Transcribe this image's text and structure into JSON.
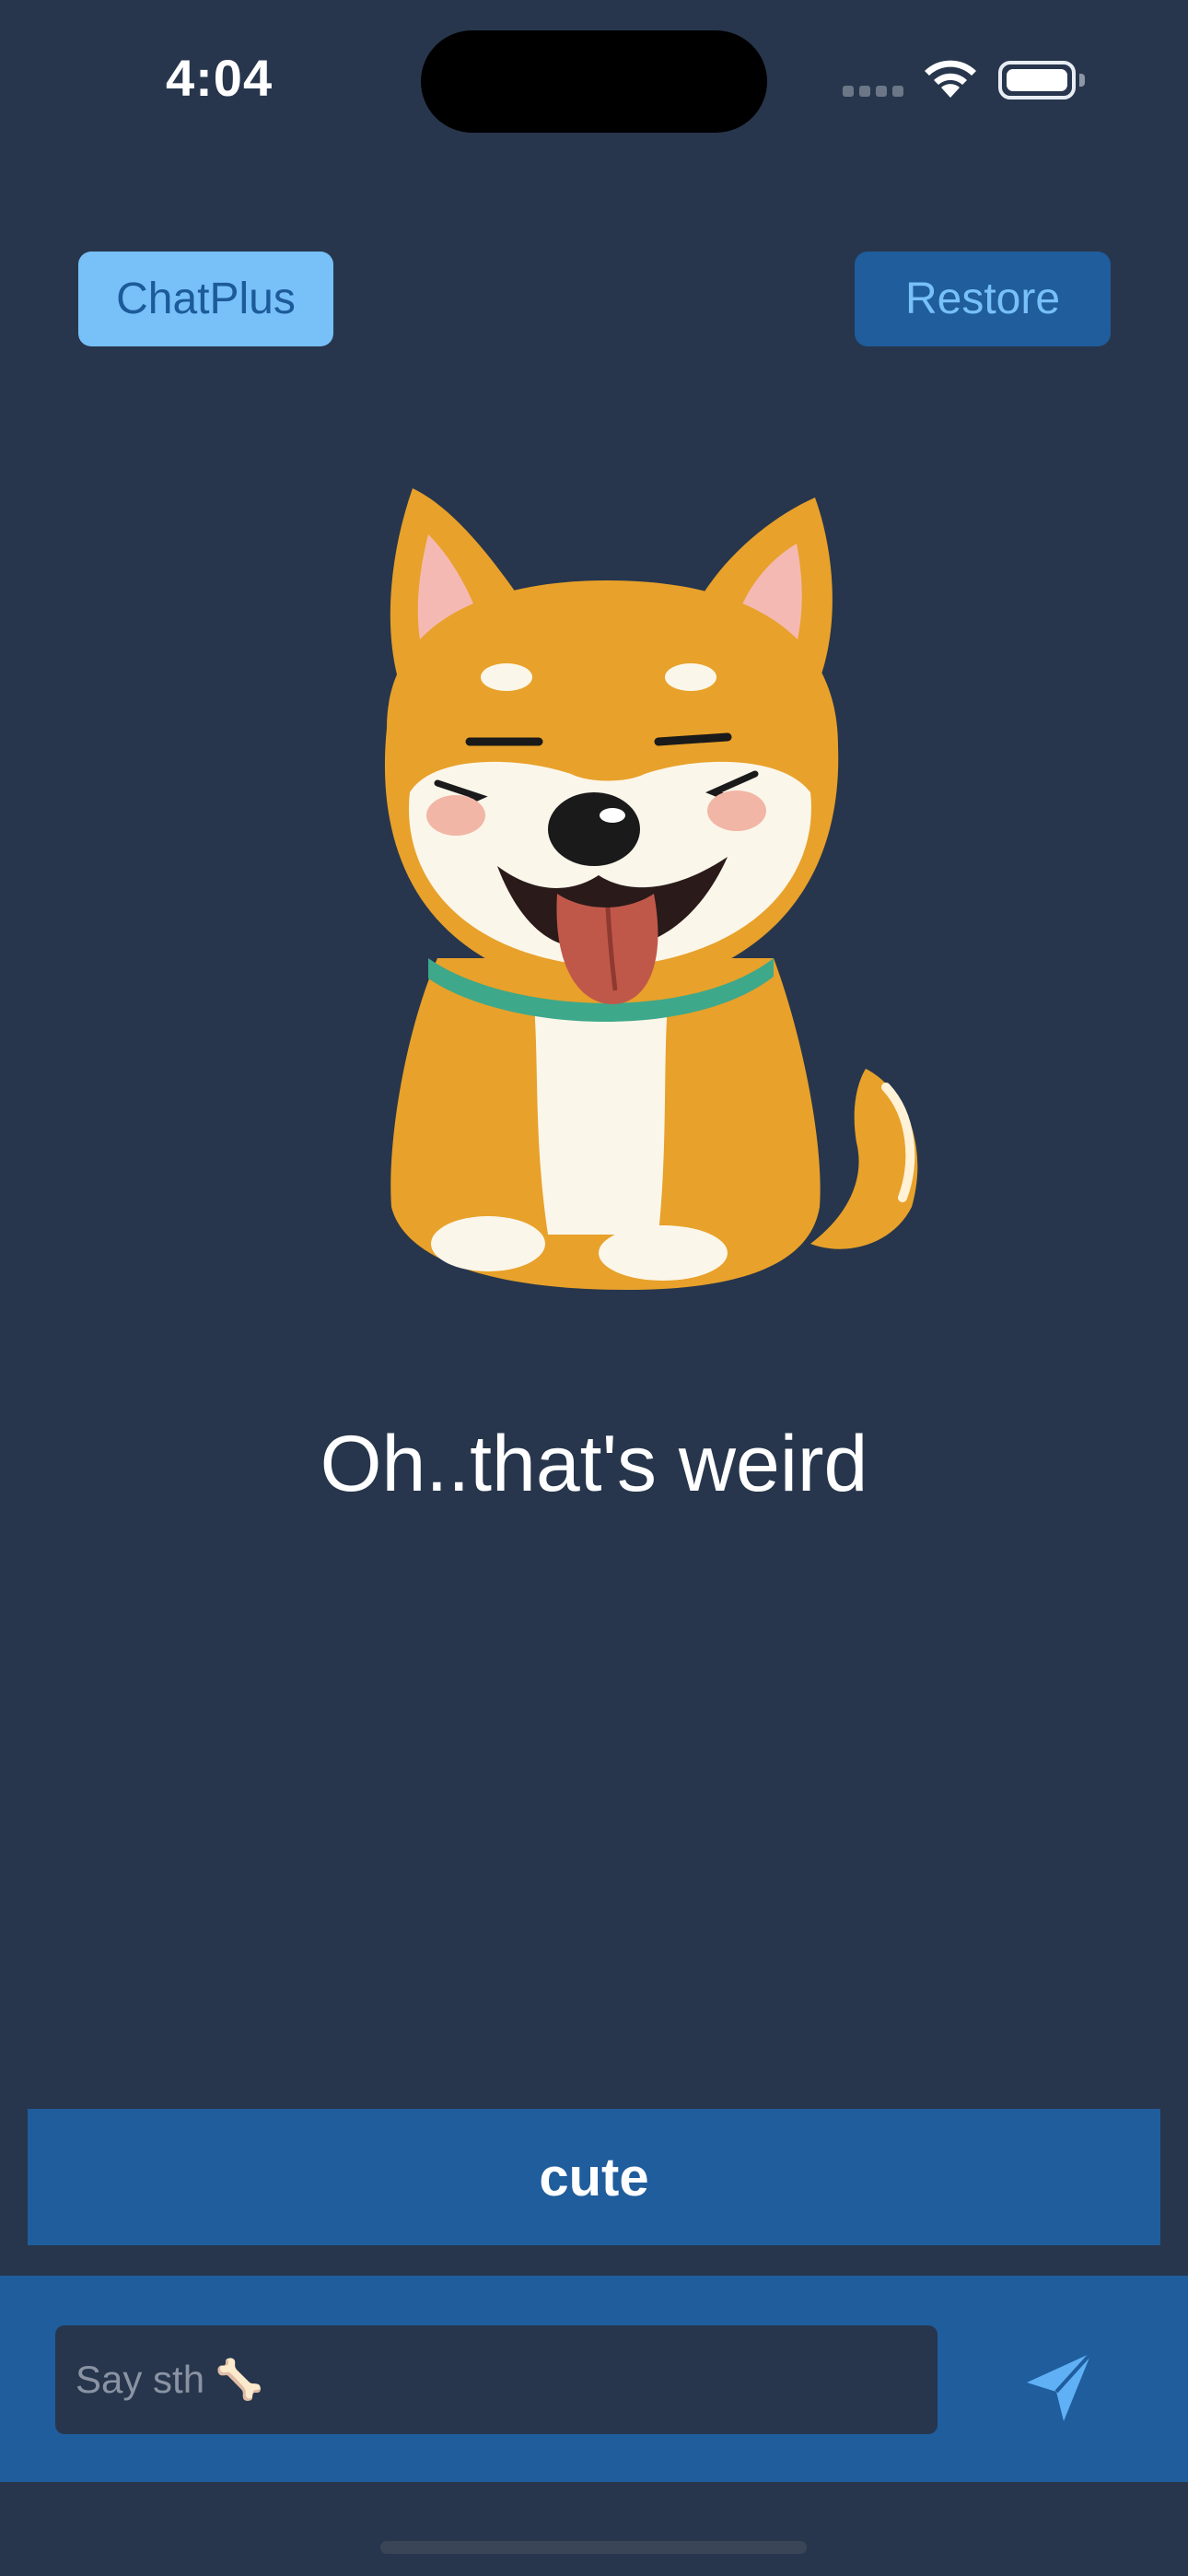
{
  "status_bar": {
    "time": "4:04",
    "icons": [
      "cellular-signal-icon",
      "wifi-icon",
      "battery-icon"
    ]
  },
  "header": {
    "chatplus_label": "ChatPlus",
    "restore_label": "Restore"
  },
  "mascot": {
    "icon": "shiba-dog-illustration"
  },
  "message": {
    "text": "Oh..that's weird"
  },
  "reply": {
    "label": "cute"
  },
  "composer": {
    "placeholder": "Say sth 🦴",
    "value": "",
    "send_icon": "paper-plane-icon"
  },
  "colors": {
    "background": "#27364c",
    "primary_blue": "#1f5d9c",
    "light_blue": "#77c0f8",
    "dog_orange": "#e8a12a"
  }
}
